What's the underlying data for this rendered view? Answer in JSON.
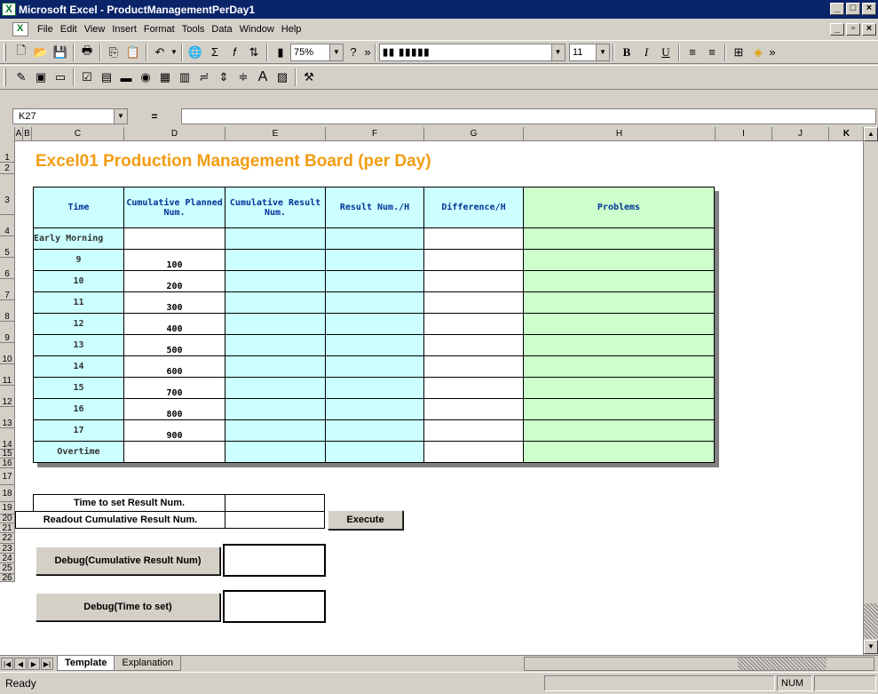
{
  "window": {
    "title": "Microsoft Excel - ProductManagementPerDay1"
  },
  "menu": [
    "File",
    "Edit",
    "View",
    "Insert",
    "Format",
    "Tools",
    "Data",
    "Window",
    "Help"
  ],
  "toolbar": {
    "zoom": "75%",
    "font_name": "▮▮ ▮▮▮▮▮",
    "font_size": "11"
  },
  "formula": {
    "cell_ref": "K27",
    "eq": "=",
    "content": ""
  },
  "columns": [
    "A",
    "B",
    "C",
    "D",
    "E",
    "F",
    "G",
    "H",
    "I",
    "J",
    "K"
  ],
  "rows": [
    "1",
    "2",
    "3",
    "4",
    "5",
    "6",
    "7",
    "8",
    "9",
    "10",
    "11",
    "12",
    "13",
    "14",
    "15",
    "16",
    "17",
    "18",
    "19",
    "20",
    "21",
    "22",
    "23",
    "24",
    "25",
    "26"
  ],
  "sheet": {
    "title": "Excel01 Production Management Board (per Day)",
    "headers": [
      "Time",
      "Cumulative Planned Num.",
      "Cumulative Result Num.",
      "Result Num./H",
      "Difference/H",
      "Problems"
    ],
    "time_rows": [
      {
        "time": "Early Morning",
        "planned": ""
      },
      {
        "time": "9",
        "planned": "100"
      },
      {
        "time": "10",
        "planned": "200"
      },
      {
        "time": "11",
        "planned": "300"
      },
      {
        "time": "12",
        "planned": "400"
      },
      {
        "time": "13",
        "planned": "500"
      },
      {
        "time": "14",
        "planned": "600"
      },
      {
        "time": "15",
        "planned": "700"
      },
      {
        "time": "16",
        "planned": "800"
      },
      {
        "time": "17",
        "planned": "900"
      },
      {
        "time": "Overtime",
        "planned": ""
      }
    ],
    "time_to_set_label": "Time to set Result Num.",
    "readout_label": "Readout Cumulative Result Num.",
    "execute_button": "Execute",
    "debug_cum_button": "Debug(Cumulative Result Num)",
    "debug_time_button": "Debug(Time to set)"
  },
  "tabs": [
    "Template",
    "Explanation"
  ],
  "status": {
    "text": "Ready",
    "num": "NUM"
  },
  "colors": {
    "title": "#f39c12",
    "cyan": "#ccffff",
    "green": "#ccffcc",
    "header_text": "#003399"
  }
}
